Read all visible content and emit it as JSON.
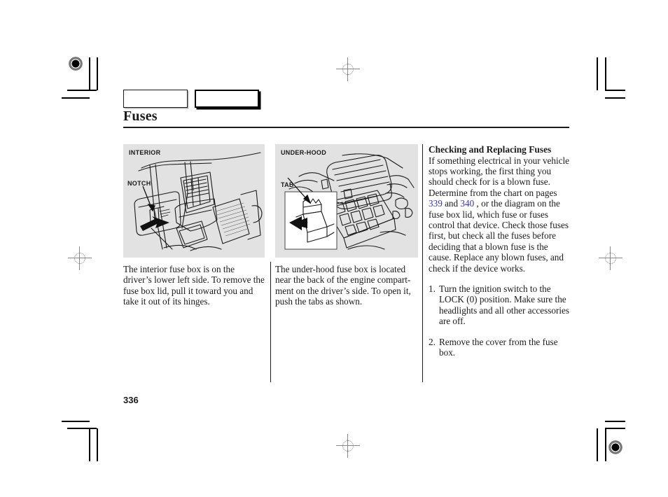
{
  "document": {
    "title": "Fuses",
    "page_number": "336"
  },
  "header": {
    "tabs": [
      {
        "label": "",
        "state": "inactive"
      },
      {
        "label": "",
        "state": "active"
      }
    ]
  },
  "columns": {
    "interior": {
      "figure_label": "INTERIOR",
      "callout": "NOTCH",
      "caption": "The interior fuse box is on the driver’s lower left side. To remove the fuse box lid, pull it toward you and take it out of its hinges."
    },
    "under_hood": {
      "figure_label": "UNDER-HOOD",
      "callout": "TAB",
      "caption": "The under-hood fuse box is located near the back of the engine compart-ment on the driver’s side. To open it, push the tabs as shown."
    },
    "checking": {
      "heading": "Checking and Replacing Fuses",
      "intro_part1": "If something electrical in your vehicle stops working, the first thing you should check for is a blown fuse. Determine from the chart on pages",
      "link_page_1": "339",
      "between_links": "and",
      "link_page_2": "340",
      "intro_part2": ", or the diagram on the fuse box lid, which fuse or fuses control that device. Check those fuses first, but check all the fuses before deciding that a blown fuse is the cause. Replace any blown fuses, and check if the device works.",
      "steps": [
        {
          "number": "1.",
          "text": "Turn the ignition switch to the LOCK (0) position. Make sure the headlights and all other accessories are off."
        },
        {
          "number": "2.",
          "text": "Remove the cover from the fuse box."
        }
      ]
    }
  },
  "colors": {
    "link": "#3333cc",
    "figure_background": "#e2e2e2",
    "text": "#1a1a1a"
  }
}
